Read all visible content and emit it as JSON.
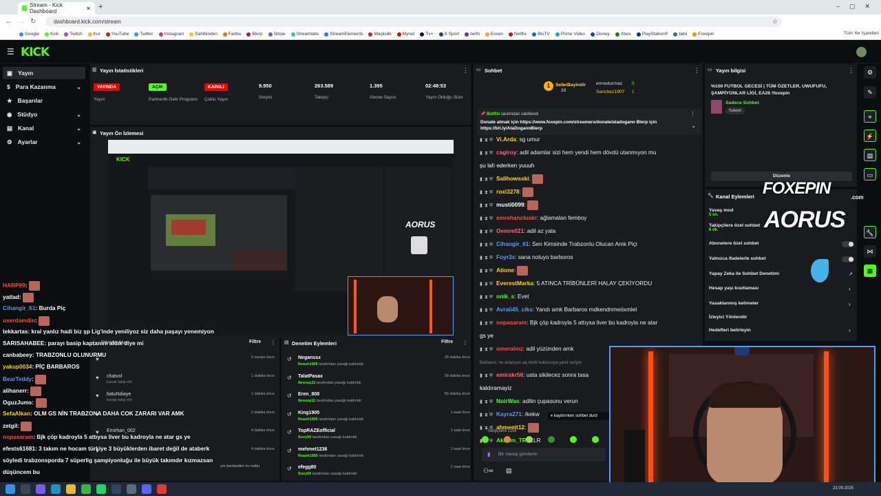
{
  "browser": {
    "tab_title": "Stream - Kick Dashboard",
    "url": "dashboard.kick.com/stream",
    "bookmarks": [
      "Google",
      "Kick",
      "Twitch",
      "Kur",
      "YouTube",
      "Twitter",
      "Instagram",
      "Sahibinden",
      "Faribu",
      "Blerp",
      "Stripe",
      "Streamlabs",
      "StreamElements",
      "Maçkolik",
      "Mynet",
      "Tv+",
      "S Sport",
      "beIN",
      "Exxen",
      "Netflix",
      "BluTV",
      "Prime Video",
      "Disney",
      "Xbox",
      "PlayStation®",
      "tabii",
      "Foxepin"
    ],
    "all_bookmarks": "Tüm Yer İşaretleri"
  },
  "kick": {
    "logo": "KICK"
  },
  "nav": {
    "items": [
      {
        "label": "Yayın"
      },
      {
        "label": "Para Kazanma"
      },
      {
        "label": "Başarılar"
      },
      {
        "label": "Stüdyo"
      },
      {
        "label": "Kanal"
      },
      {
        "label": "Ayarlar"
      }
    ]
  },
  "stats": {
    "title": "Yayın İstatistikleri",
    "items": [
      {
        "value": "YAYINDA",
        "label": "Yayın",
        "color": "#eb0400"
      },
      {
        "value": "AÇIK",
        "label": "Partnerlik Gelir Programı",
        "color": "#53fc18"
      },
      {
        "value": "KAPALI",
        "label": "Çoklu Yayın",
        "color": "#eb0400"
      },
      {
        "value": "9.950",
        "label": "İzleyici"
      },
      {
        "value": "263.589",
        "label": "Takipçi"
      },
      {
        "value": "1.395",
        "label": "Abone Sayısı"
      },
      {
        "value": "02:48:53",
        "label": "Yayın Olduğu Süre"
      }
    ]
  },
  "preview": {
    "title": "Yayın Ön İzlemesi"
  },
  "activity": {
    "title": "Etkinlik Akışı",
    "filter": "Filtre",
    "rows": [
      {
        "name": "",
        "sub": "",
        "time": "0 saniye önce"
      },
      {
        "name": "chatvol",
        "sub": "kanalı takip etti",
        "time": "1 dakika önce"
      },
      {
        "name": "batuNdiaye",
        "sub": "kanalı takip etti",
        "time": "1 dakika önce"
      },
      {
        "name": "",
        "sub": "",
        "time": "2 dakika önce"
      },
      {
        "name": "Emirhan_002",
        "sub": "",
        "time": "4 dakika önce"
      },
      {
        "name": "",
        "sub": "",
        "time": "4 dakika önce"
      }
    ],
    "footer": "yor benlandim mı noldu"
  },
  "moderation": {
    "title": "Denetim Eylemleri",
    "filter": "Filtre",
    "rows": [
      {
        "name": "Neganssx",
        "by": "Reash1905",
        "sub": "tarafından yasağı kaldırıldı",
        "time": "29 dakika önce"
      },
      {
        "name": "TalatPasax",
        "by": "tkrecep11",
        "sub": "tarafından yasağı kaldırıldı",
        "time": "39 dakika önce"
      },
      {
        "name": "Eren_808",
        "by": "tkrecep11",
        "sub": "tarafından yasağı kaldırıldı",
        "time": "56 dakika önce"
      },
      {
        "name": "King1905",
        "by": "Reash1905",
        "sub": "tarafından yasağı kaldırıldı",
        "time": "1 saat önce"
      },
      {
        "name": "TopRAZEofficial",
        "by": "Sovy06",
        "sub": "tarafından yasağı kaldırıldı",
        "time": "1 saat önce"
      },
      {
        "name": "mehmet1236",
        "by": "Reash1905",
        "sub": "tarafından yasağı kaldırıldı",
        "time": "1 saat önce"
      },
      {
        "name": "efegg80",
        "by": "Sovy06",
        "sub": "tarafından yasağı kaldırıldı",
        "time": "2 saat önce"
      }
    ]
  },
  "overlay_chat": [
    {
      "user": "HARP99",
      "color": "#ff4d4d",
      "msg": "",
      "emote": true
    },
    {
      "user": "yatlad",
      "color": "#ffffff",
      "msg": "",
      "emote": true
    },
    {
      "user": "Cihangir_61",
      "color": "#5b9cf0",
      "msg": "Burda Piç"
    },
    {
      "user": "userdamdin",
      "color": "#ff4d4d",
      "msg": "",
      "emote": true
    },
    {
      "user": "tekkartas",
      "color": "#ffffff",
      "msg": "kral yanlız hadi biz şp Lig'inde yeniliyoz siz daha paşayı yenemiyon"
    },
    {
      "user": "SARISAHABEE",
      "color": "#ffffff",
      "msg": "parayı basip kaptanını aldık diye mi"
    },
    {
      "user": "canbabeey",
      "color": "#ffffff",
      "msg": "TRABZONLU OLUNURMU"
    },
    {
      "user": "yakup0034",
      "color": "#ffd700",
      "msg": "PİÇ BARBAROS"
    },
    {
      "user": "BearTeddy",
      "color": "#5b9cf0",
      "msg": "",
      "emote": true
    },
    {
      "user": "alihanerr",
      "color": "#ffffff",
      "msg": "",
      "emote": true
    },
    {
      "user": "OguzJums",
      "color": "#ffffff",
      "msg": "",
      "emote": true
    },
    {
      "user": "SefaAlkan",
      "color": "#ffd700",
      "msg": "OLM GS NİN TRABZONA DAHA COK ZARARI VAR AMK"
    },
    {
      "user": "zetgil",
      "color": "#ffffff",
      "msg": "",
      "emote": true
    },
    {
      "user": "nopasaram",
      "color": "#ff4d4d",
      "msg": "Bjk çöp kadroyla 5 attıysa liver bu kadroyla ne atar gs ye"
    },
    {
      "user": "efests61681",
      "color": "#ffffff",
      "msg": "3 takım ne hocam türkiye 3 büyüklerden ibaret değil de ataberk"
    },
    {
      "user": "",
      "color": "#ffffff",
      "msg": "söyledi trabzonsporda 7 süperlig şampiyonluğu ile büyük takımdır kızmazsan"
    },
    {
      "user": "",
      "color": "#ffffff",
      "msg": "düşüncem bu"
    }
  ],
  "chat": {
    "title": "Sohbet",
    "top_users": [
      {
        "name": "SeferBayindir",
        "count": "10"
      },
      {
        "name": "emredurmaz",
        "count": "5"
      },
      {
        "name": "Sanchez1907",
        "count": "1"
      }
    ],
    "pinned": {
      "user": "BotRix",
      "label": "tarafından sabitlendi",
      "text": "Donate atmak için https://www.foxepin.com/streamers/donate/atadogann Blerp için https://bit.ly/AtaDogannBlerp"
    },
    "messages": [
      {
        "user": "Vi.Arda",
        "color": "#ffd700",
        "msg": "sg umur"
      },
      {
        "user": "cagiroy",
        "color": "#ff6b6b",
        "msg": "adil adamlar sizi hem yendi hem dövdü utanmıyon mu"
      },
      {
        "user": "",
        "color": "#ffffff",
        "msg": "şu lafı ederken yuuuh"
      },
      {
        "user": "Salihowsski",
        "color": "#ffd700",
        "msg": "",
        "emote": true
      },
      {
        "user": "roxi3278",
        "color": "#ffd700",
        "msg": "",
        "emote": true
      },
      {
        "user": "musti0099",
        "color": "#ffffff",
        "msg": "",
        "emote": true
      },
      {
        "user": "emrehancluskr",
        "color": "#ff4d4d",
        "msg": "ağlamalan femboy"
      },
      {
        "user": "Oemre021",
        "color": "#ff6b6b",
        "msg": "adil az yala"
      },
      {
        "user": "Cihangir_61",
        "color": "#5b9cf0",
        "msg": "Sen Kimsinde Trabzonlu Olucan Amk Piçi"
      },
      {
        "user": "Foyr3x",
        "color": "#5b9cf0",
        "msg": "sana noluyo barboros"
      },
      {
        "user": "Atione",
        "color": "#ffd700",
        "msg": "",
        "emote": true
      },
      {
        "user": "EverestMarka",
        "color": "#ffd700",
        "msg": "5 ATINCA TRİBÜNLERİ HALAY ÇEKİYORDU"
      },
      {
        "user": "onik_s",
        "color": "#53fc18",
        "msg": "Evet"
      },
      {
        "user": "Avrali45_ciks",
        "color": "#5b9cf0",
        "msg": "Yandı amk Barbaros mdkendnmeöxmlel"
      },
      {
        "user": "nopasaram",
        "color": "#ff4d4d",
        "msg": "Bjk çöp kadroyla 5 attıysa liver bu kadroyla ne atar"
      },
      {
        "user": "",
        "color": "#ffffff",
        "msg": "gs ye"
      },
      {
        "user": "omeralmz",
        "color": "#ff4d4d",
        "msg": "adil yüzünden amk"
      },
      {
        "user": "",
        "color": "#888888",
        "msg": "Barbaros: ne anlatıyon aq isimli kullanıcıya yanıt veriyor"
      },
      {
        "user": "emirskr56",
        "color": "#ff6b6b",
        "msg": "usta sikilecez sonra tasa"
      },
      {
        "user": "",
        "color": "#ffffff",
        "msg": "kaldıramayiz"
      },
      {
        "user": "NoirWas",
        "color": "#53fc18",
        "msg": "adilin çupasunu verun"
      },
      {
        "user": "Kayra271",
        "color": "#5b9cf0",
        "msg": "/kekw"
      },
      {
        "user": "ahmeett12",
        "color": "#ffd700",
        "msg": "",
        "emote": true
      },
      {
        "user": "Akifum_TR",
        "color": "#53fc18",
        "msg": "ELR"
      }
    ],
    "paused": "kaydırırken sohbet durd",
    "followers_only": "Takipçilere Özel",
    "input_placeholder": "Bir mesaj gönderin"
  },
  "stream_info": {
    "title": "Yayın bilgisi",
    "stream_title": "%100 FUTBOL GECESİ | TÜM ÖZETLER, UWUFUFU, ŞAMPİYONLAR LİGİ, EA26 !foxepin",
    "category": "Sadece Sohbet",
    "tag": "Turkish",
    "edit": "Düzenle"
  },
  "channel_actions": {
    "title": "Kanal Eylemleri",
    "items": [
      {
        "label": "Yavaş mod",
        "sub": "5 sn."
      },
      {
        "label": "Takipçilere özel sohbet",
        "sub": "6 dk."
      },
      {
        "label": "Abonelere özel sohbet"
      },
      {
        "label": "Yalnızca ifadelerle sohbet"
      },
      {
        "label": "Yapay Zeka ile Sohbet Denetimi"
      },
      {
        "label": "Hesap yaşı kısıtlaması"
      },
      {
        "label": "Yasaklanmış kelimeler"
      },
      {
        "label": "İzleyici Yönlendir"
      },
      {
        "label": "Hedefleri belirleyin"
      }
    ]
  },
  "overlay_brands": {
    "foxepin": "FOXEPIN",
    "foxepin_com": ".com",
    "aorus": "AORUS"
  },
  "taskbar": {
    "date": "23.09.2025"
  }
}
